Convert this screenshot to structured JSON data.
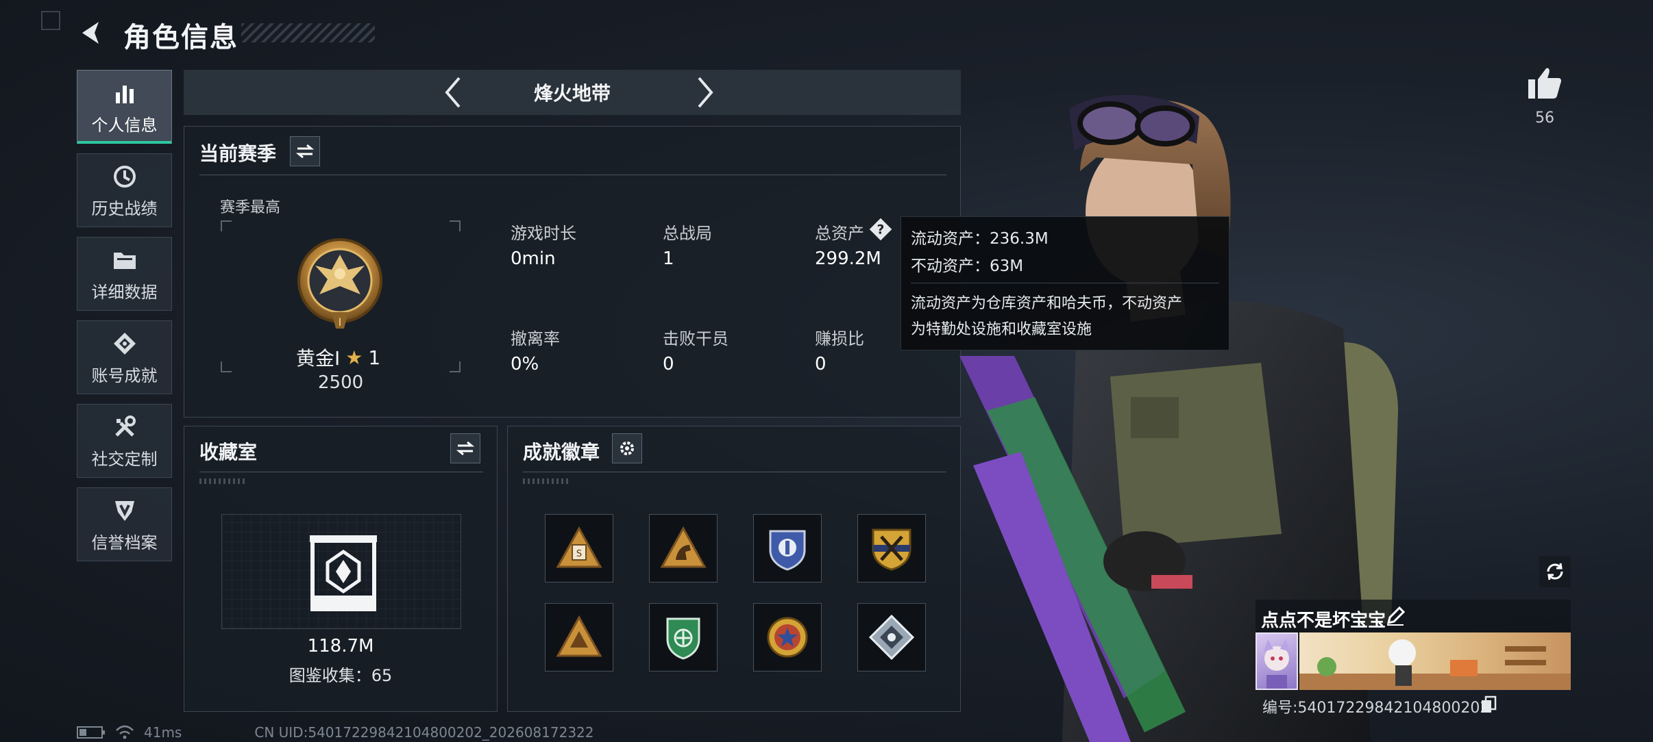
{
  "header": {
    "title": "角色信息"
  },
  "sidebar": {
    "items": [
      {
        "label": "个人信息",
        "icon": "bar-chart-icon",
        "active": true
      },
      {
        "label": "历史战绩",
        "icon": "history-clock-icon",
        "active": false
      },
      {
        "label": "详细数据",
        "icon": "folder-icon",
        "active": false
      },
      {
        "label": "账号成就",
        "icon": "achievement-icon",
        "active": false
      },
      {
        "label": "社交定制",
        "icon": "tools-icon",
        "active": false
      },
      {
        "label": "信誉档案",
        "icon": "shield-icon",
        "active": false
      }
    ]
  },
  "mode": {
    "name": "烽火地带"
  },
  "season": {
    "title": "当前赛季",
    "best_label": "赛季最高",
    "rank_name": "黄金Ⅰ",
    "rank_stars": "1",
    "rank_points": "2500",
    "stats": {
      "play_time": {
        "label": "游戏时长",
        "value": "0min"
      },
      "total_games": {
        "label": "总战局",
        "value": "1"
      },
      "total_assets": {
        "label": "总资产",
        "value": "299.2M"
      },
      "extract_rate": {
        "label": "撤离率",
        "value": "0%"
      },
      "kills": {
        "label": "击败干员",
        "value": "0"
      },
      "profit_ratio": {
        "label": "赚损比",
        "value": "0"
      }
    }
  },
  "tooltip": {
    "liquid": "流动资产：236.3M",
    "fixed": "不动资产：63M",
    "desc_line1": "流动资产为仓库资产和哈夫币，不动资产",
    "desc_line2": "为特勤处设施和收藏室设施"
  },
  "collection": {
    "title": "收藏室",
    "value": "118.7M",
    "catalog": "图鉴收集：65"
  },
  "achievements": {
    "title": "成就徽章",
    "badges": [
      {
        "icon": "triangle-s-badge-icon",
        "color": "#c9913a"
      },
      {
        "icon": "triangle-horse-badge-icon",
        "color": "#c9913a"
      },
      {
        "icon": "police-shield-badge-icon",
        "color": "#3f5aa8"
      },
      {
        "icon": "gold-crest-badge-icon",
        "color": "#d4a437"
      },
      {
        "icon": "triangle-emblem-badge-icon",
        "color": "#c9913a"
      },
      {
        "icon": "green-shield-badge-icon",
        "color": "#2f8a54"
      },
      {
        "icon": "star-wreath-badge-icon",
        "color": "#b8452f"
      },
      {
        "icon": "diamond-badge-icon",
        "color": "#9aa7b4"
      }
    ]
  },
  "profile": {
    "likes": "56",
    "name": "点点不是坏宝宝",
    "id": "编号:54017229842104800202"
  },
  "status": {
    "ping": "41ms",
    "uid": "CN UID:54017229842104800202_202608172322"
  },
  "colors": {
    "accent": "#2ec7a0",
    "gold": "#c9913a",
    "panel_border": "#3c4653"
  }
}
